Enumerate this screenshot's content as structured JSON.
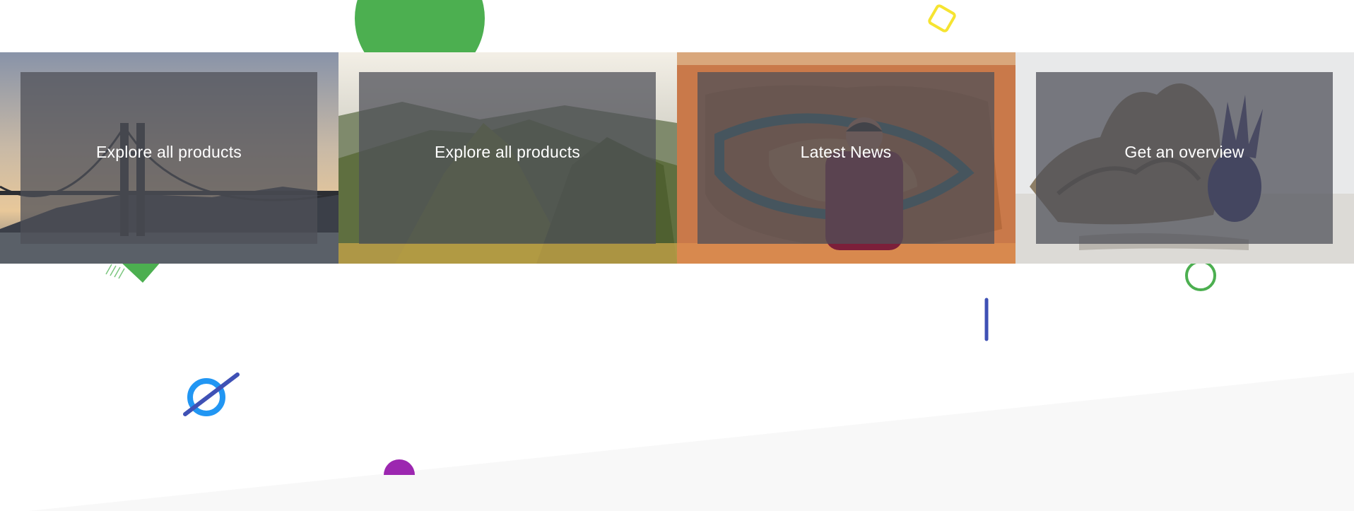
{
  "tiles": [
    {
      "id": "golden-gate",
      "label": "Explore all products",
      "image": "golden-gate-bridge-photo"
    },
    {
      "id": "mountain-ridge",
      "label": "Explore all products",
      "image": "mountain-ridge-hiker-photo"
    },
    {
      "id": "canyon",
      "label": "Latest News",
      "image": "canyon-viewer-photo"
    },
    {
      "id": "beach-pineapple",
      "label": "Get an overview",
      "image": "driftwood-pineapple-beach-photo"
    }
  ],
  "colors": {
    "overlay": "#4e5058",
    "green": "#4caf50",
    "yellow": "#f6e431",
    "blue": "#2196f3",
    "indigo": "#3f51b5",
    "purple": "#9c27b0",
    "slant": "#f8f8f8"
  }
}
